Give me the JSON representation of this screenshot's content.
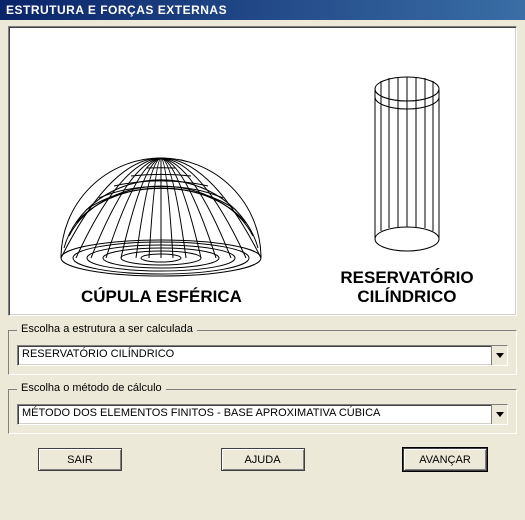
{
  "window": {
    "title": "ESTRUTURA E FORÇAS EXTERNAS"
  },
  "panel": {
    "dome_label": "CÚPULA ESFÉRICA",
    "cylinder_label": "RESERVATÓRIO\nCILÍNDRICO"
  },
  "group_structure": {
    "legend": "Escolha a estrutura a ser calculada",
    "selected": "RESERVATÓRIO CILÍNDRICO"
  },
  "group_method": {
    "legend": "Escolha o método de cálculo",
    "selected": "MÉTODO DOS ELEMENTOS FINITOS - BASE APROXIMATIVA CÚBICA"
  },
  "buttons": {
    "exit": "SAIR",
    "help": "AJUDA",
    "next": "AVANÇAR"
  }
}
